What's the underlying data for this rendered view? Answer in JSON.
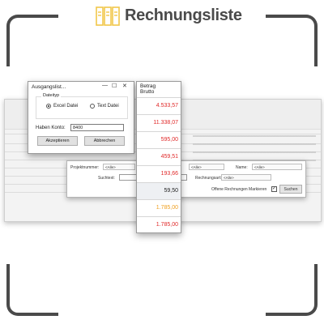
{
  "header": {
    "title": "Rechnungsliste",
    "logo_icon": "invoice-list-icon"
  },
  "colors": {
    "red": "#e02a2a",
    "orange": "#f0a020",
    "dark": "#222222",
    "frame": "#4a4a4a",
    "logo": "#f2c74a"
  },
  "dialog": {
    "title": "Ausgangslist...",
    "controls": {
      "minimize": "—",
      "maximize": "☐",
      "close": "✕"
    },
    "group_label": "Dateityp",
    "options": [
      {
        "label": "Excel Datei",
        "selected": true
      },
      {
        "label": "Text Datei",
        "selected": false
      }
    ],
    "konto_label": "Haben Konto:",
    "konto_value": "8400",
    "accept_label": "Akzeptieren",
    "cancel_label": "Abbrechen"
  },
  "amount_column": {
    "header_line1": "Betrag",
    "header_line2": "Brutto",
    "rows": [
      {
        "value": "4.533,57",
        "status": "red"
      },
      {
        "value": "11.338,07",
        "status": "red"
      },
      {
        "value": "595,00",
        "status": "red"
      },
      {
        "value": "459,51",
        "status": "red"
      },
      {
        "value": "193,66",
        "status": "red"
      },
      {
        "value": "59,50",
        "status": "dark"
      },
      {
        "value": "1.785,00",
        "status": "orange"
      },
      {
        "value": "1.785,00",
        "status": "red"
      }
    ]
  },
  "filter": {
    "projekt_label": "Projektnummer:",
    "projekt_value": "<Alle>",
    "second_value": "<Alle>",
    "name_label": "Name:",
    "name_value": "<Alle>",
    "suchtext_label": "Suchtext:",
    "rechnungsart_label": "Rechnungsart:",
    "rechnungsart_value": "<Alle>",
    "offene_label": "Offene Rechnungen Markieren",
    "offene_checked": "✓",
    "suchen_label": "Suchen"
  }
}
